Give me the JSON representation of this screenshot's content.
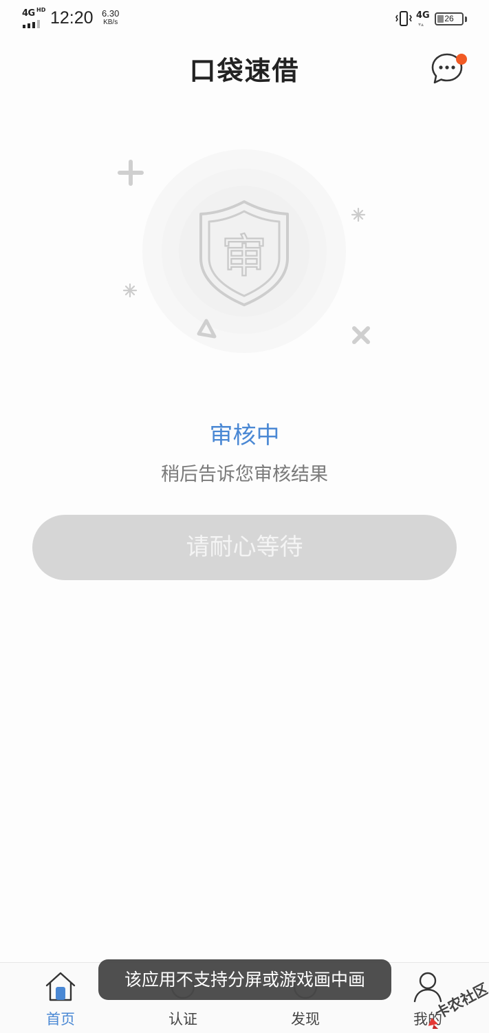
{
  "status_bar": {
    "network_left": "4G",
    "network_left_hd": "HD",
    "time": "12:20",
    "speed_value": "6.30",
    "speed_unit": "KB/s",
    "network_right": "4G",
    "battery": "26",
    "battery_level_percent": 26
  },
  "header": {
    "title": "口袋速借",
    "message_icon": "chat-bubble-icon"
  },
  "review": {
    "title": "审核中",
    "subtitle": "稍后告诉您审核结果",
    "shield_char": "审"
  },
  "button": {
    "label": "请耐心等待"
  },
  "nav": {
    "items": [
      {
        "label": "首页",
        "icon": "home-icon",
        "active": true
      },
      {
        "label": "认证",
        "icon": "verify-icon",
        "active": false
      },
      {
        "label": "发现",
        "icon": "discover-icon",
        "active": false
      },
      {
        "label": "我的",
        "icon": "profile-icon",
        "active": false
      }
    ]
  },
  "toast": {
    "text": "该应用不支持分屏或游戏画中画"
  },
  "watermark": {
    "text": "卡农社区"
  },
  "colors": {
    "accent": "#4a88d4",
    "badge": "#f15a24",
    "button_bg": "#d6d6d6"
  }
}
